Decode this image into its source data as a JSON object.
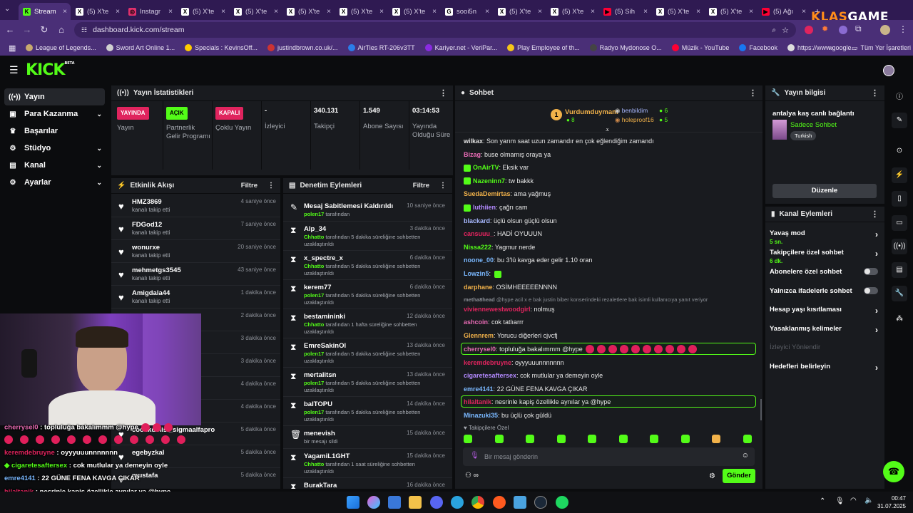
{
  "browser": {
    "tabs": [
      {
        "label": "Stream",
        "fav": "K",
        "color": "#53fc18"
      },
      {
        "label": "(5) X'te",
        "fav": "X",
        "color": "#ffffff"
      },
      {
        "label": "Instagr",
        "fav": "◎",
        "color": "#e1306c"
      },
      {
        "label": "(5) X'te",
        "fav": "X",
        "color": "#ffffff"
      },
      {
        "label": "(5) X'te",
        "fav": "X",
        "color": "#ffffff"
      },
      {
        "label": "(5) X'te",
        "fav": "X",
        "color": "#ffffff"
      },
      {
        "label": "(5) X'te",
        "fav": "X",
        "color": "#ffffff"
      },
      {
        "label": "(5) X'te",
        "fav": "X",
        "color": "#ffffff"
      },
      {
        "label": "sooi5n",
        "fav": "G",
        "color": "#ffffff"
      },
      {
        "label": "(5) X'te",
        "fav": "X",
        "color": "#ffffff"
      },
      {
        "label": "(5) X'te",
        "fav": "X",
        "color": "#ffffff"
      },
      {
        "label": "(5) Sih",
        "fav": "▶",
        "color": "#ff0033"
      },
      {
        "label": "(5) X'te",
        "fav": "X",
        "color": "#ffffff"
      },
      {
        "label": "(5) X'te",
        "fav": "X",
        "color": "#ffffff"
      },
      {
        "label": "(5) Ağı",
        "fav": "▶",
        "color": "#ff0033"
      }
    ],
    "url": "dashboard.kick.com/stream",
    "bookmarks": [
      {
        "label": "League of Legends...",
        "color": "#c8aa6e"
      },
      {
        "label": "Sword Art Online 1...",
        "color": "#d0d0d0"
      },
      {
        "label": "Specials : KevinsOff...",
        "color": "#ffcc00"
      },
      {
        "label": "justindbrown.co.uk/...",
        "color": "#cc3333"
      },
      {
        "label": "AirTies RT-206v3TT",
        "color": "#2b7de9"
      },
      {
        "label": "Kariyer.net - VeriPar...",
        "color": "#8a2be2"
      },
      {
        "label": "Play Employee of th...",
        "color": "#f5c518"
      },
      {
        "label": "Radyo Mydonose O...",
        "color": "#444444"
      },
      {
        "label": "Müzik - YouTube",
        "color": "#ff0033"
      },
      {
        "label": "Facebook",
        "color": "#1877f2"
      },
      {
        "label": "https://www.google...",
        "color": "#dddddd"
      }
    ],
    "all_bookmarks": "Tüm Yer İşaretleri",
    "watermark_a": "KLAS",
    "watermark_b": "GAME"
  },
  "kick": {
    "logo": "KICK",
    "logo_sup": "BETA",
    "sidebar": [
      {
        "label": "Yayın",
        "icon": "((•))",
        "active": true,
        "chev": false
      },
      {
        "label": "Para Kazanma",
        "icon": "▣",
        "active": false,
        "chev": true
      },
      {
        "label": "Başarılar",
        "icon": "♛",
        "active": false,
        "chev": false
      },
      {
        "label": "Stüdyo",
        "icon": "⚙",
        "active": false,
        "chev": true
      },
      {
        "label": "Kanal",
        "icon": "▤",
        "active": false,
        "chev": true
      },
      {
        "label": "Ayarlar",
        "icon": "⚙",
        "active": false,
        "chev": true
      }
    ],
    "stats": {
      "title": "Yayın İstatistikleri",
      "items": [
        {
          "badge": "YAYINDA",
          "badge_color": "#e0245e",
          "label": "Yayın"
        },
        {
          "badge": "AÇIK",
          "badge_color": "#53fc18",
          "label": "Partnerlik Gelir Programı"
        },
        {
          "badge": "KAPALI",
          "badge_color": "#e0245e",
          "label": "Çoklu Yayın"
        },
        {
          "value": "-",
          "label": "İzleyici"
        },
        {
          "value": "340.131",
          "label": "Takipçi"
        },
        {
          "value": "1.549",
          "label": "Abone Sayısı"
        },
        {
          "value": "03:14:53",
          "label": "Yayında Olduğu Süre"
        }
      ]
    },
    "activity": {
      "title": "Etkinlik Akışı",
      "filter": "Filtre",
      "rows": [
        {
          "name": "HMZ3869",
          "sub": "kanalı takip etti",
          "time": "4 saniye önce"
        },
        {
          "name": "FDGod12",
          "sub": "kanalı takip etti",
          "time": "7 saniye önce"
        },
        {
          "name": "wonurxe",
          "sub": "kanalı takip etti",
          "time": "20 saniye önce"
        },
        {
          "name": "mehmetgs3545",
          "sub": "kanalı takip etti",
          "time": "43 saniye önce"
        },
        {
          "name": "Amigdala44",
          "sub": "kanalı takip etti",
          "time": "1 dakika önce"
        },
        {
          "name": "",
          "sub": "",
          "time": "2 dakika önce"
        },
        {
          "name": "",
          "sub": "",
          "time": "3 dakika önce"
        },
        {
          "name": "",
          "sub": "",
          "time": "3 dakika önce"
        },
        {
          "name": "oldu!",
          "sub": "",
          "time": "4 dakika önce"
        },
        {
          "name": "",
          "sub": "",
          "time": "4 dakika önce"
        },
        {
          "name": "cocukdelisi_sigmaalfapro",
          "sub": "",
          "time": "5 dakika önce"
        },
        {
          "name": "egebyzkal",
          "sub": "",
          "time": "5 dakika önce"
        },
        {
          "name": "mustafa",
          "sub": "",
          "time": "5 dakika önce"
        }
      ]
    },
    "moderation": {
      "title": "Denetim Eylemleri",
      "filter": "Filtre",
      "rows": [
        {
          "icon": "✎",
          "name": "Mesaj Sabitlemesi Kaldırıldı",
          "by": "polen17",
          "rest": " tarafından",
          "time": "10 saniye önce"
        },
        {
          "icon": "⧗",
          "name": "Alp_34",
          "by": "Chhatto",
          "rest": " tarafından 5 dakika süreliğine sohbetten uzaklaştırıldı",
          "time": "3 dakika önce"
        },
        {
          "icon": "⧗",
          "name": "x_spectre_x",
          "by": "Chhatto",
          "rest": " tarafından 5 dakika süreliğine sohbetten uzaklaştırıldı",
          "time": "6 dakika önce"
        },
        {
          "icon": "⧗",
          "name": "kerem77",
          "by": "polen17",
          "rest": " tarafından 5 dakika süreliğine sohbetten uzaklaştırıldı",
          "time": "6 dakika önce"
        },
        {
          "icon": "⧗",
          "name": "bestamininki",
          "by": "Chhatto",
          "rest": " tarafından 1 hafta süreliğine sohbetten uzaklaştırıldı",
          "time": "12 dakika önce"
        },
        {
          "icon": "⧗",
          "name": "EmreSakinOl",
          "by": "polen17",
          "rest": " tarafından 5 dakika süreliğine sohbetten uzaklaştırıldı",
          "time": "13 dakika önce"
        },
        {
          "icon": "⧗",
          "name": "mertalitsn",
          "by": "polen17",
          "rest": " tarafından 5 dakika süreliğine sohbetten uzaklaştırıldı",
          "time": "13 dakika önce"
        },
        {
          "icon": "⧗",
          "name": "baITOPU",
          "by": "polen17",
          "rest": " tarafından 5 dakika süreliğine sohbetten uzaklaştırıldı",
          "time": "14 dakika önce"
        },
        {
          "icon": "🗑",
          "name": "menevish",
          "by": "",
          "rest": "bir mesajı sildi",
          "time": "15 dakika önce"
        },
        {
          "icon": "⧗",
          "name": "YagamiL1GHT",
          "by": "Chhatto",
          "rest": " tarafından 1 saat süreliğine sohbetten uzaklaştırıldı",
          "time": "15 dakika önce"
        },
        {
          "icon": "⧗",
          "name": "BurakTara",
          "by": "",
          "rest": "",
          "time": "16 dakika önce"
        }
      ]
    },
    "chat": {
      "title": "Sohbet",
      "top": [
        {
          "name": "Vurdumduymam",
          "count": "8"
        },
        {
          "name": "benbildim",
          "count": "6"
        },
        {
          "name": "holeproof16",
          "count": "5"
        }
      ],
      "messages": [
        {
          "user": "wilkax",
          "color": "#e0e0e0",
          "text": "Son yarım saat uzun zamandır en çok eğlendiğim zamandı",
          "hl": false
        },
        {
          "user": "Bizag",
          "color": "#e86bb5",
          "text": "buse olmamış oraya ya",
          "hl": false
        },
        {
          "user": "OnAirTV",
          "color": "#53fc18",
          "text": "Eksik var",
          "hl": false
        },
        {
          "user": "Nazeninn7",
          "color": "#53fc18",
          "text": "tw bakkk",
          "hl": false
        },
        {
          "user": "SuedaDemirtas",
          "color": "#f2b24a",
          "text": "ama yağmuş",
          "hl": false
        },
        {
          "user": "luthiien",
          "color": "#b38aff",
          "text": "çağrı cam",
          "hl": false
        },
        {
          "user": "blackard",
          "color": "#a8b8ff",
          "text": "üçlü olsun güçlü olsun",
          "hl": false
        },
        {
          "user": "cansuuu_",
          "color": "#e0245e",
          "text": "HADİ OYUUUN",
          "hl": false
        },
        {
          "user": "Nissa222",
          "color": "#53fc18",
          "text": "Yagmur nerde",
          "hl": false
        },
        {
          "user": "noone_00",
          "color": "#7ab8ff",
          "text": "bu 3'lü kavga eder gelir 1.10 oran",
          "hl": false
        },
        {
          "user": "Lowzin5",
          "color": "#7ab8ff",
          "text": "",
          "hl": false
        },
        {
          "user": "darphane",
          "color": "#f2b24a",
          "text": "OSİMHEEEEENNNN",
          "hl": false
        },
        {
          "user": "metha8head",
          "color": "#8b8f96",
          "text": "@hype acil x e bak justin biber konserindeki rezaletlere bak isimli kullanıcıya yanıt veriyor",
          "hl": false
        },
        {
          "user": "viviennewestwoodgirl",
          "color": "#e0245e",
          "text": "nolmuş",
          "hl": false
        },
        {
          "user": "ashcoin",
          "color": "#e86bb5",
          "text": "cok tatlıarrr",
          "hl": false
        },
        {
          "user": "Glennrem",
          "color": "#f2b24a",
          "text": "Yorucu diğerleri cjvcfj",
          "hl": false
        },
        {
          "user": "cherrysel0",
          "color": "#e86bb5",
          "text": "topluluğa bakalımmm @hype",
          "hl": true
        },
        {
          "user": "keremdebruyne",
          "color": "#e0245e",
          "text": "oyyyuuunnnnnnn",
          "hl": false
        },
        {
          "user": "cigaretesaftersex",
          "color": "#b38aff",
          "text": "cok mutlular ya demeyin oyle",
          "hl": false
        },
        {
          "user": "emre4141",
          "color": "#7ab8ff",
          "text": "22 GÜNE FENA KAVGA ÇIKAR",
          "hl": false
        },
        {
          "user": "hilaltanik",
          "color": "#e0245e",
          "text": "nesrinle kapiş özellikle aynılar ya @hype",
          "hl": true
        },
        {
          "user": "Minazuki35",
          "color": "#7ab8ff",
          "text": "bu üçlü çok güldü",
          "hl": false
        }
      ],
      "followers_only": "Takipçilere Özel",
      "placeholder": "Bir mesaj gönderin",
      "send": "Gönder"
    },
    "stream_info": {
      "title": "Yayın bilgisi",
      "stream_title": "antalya kaş canlı bağlantı",
      "category": "Sadece Sohbet",
      "tag": "Turkish",
      "edit": "Düzenle"
    },
    "channel_actions": {
      "title": "Kanal Eylemleri",
      "rows": [
        {
          "label": "Yavaş mod",
          "sub": "5 sn.",
          "kind": "arrow"
        },
        {
          "label": "Takipçilere özel sohbet",
          "sub": "6 dk.",
          "kind": "arrow"
        },
        {
          "label": "Abonelere özel sohbet",
          "sub": "",
          "kind": "toggle"
        },
        {
          "label": "Yalnızca ifadelerle sohbet",
          "sub": "",
          "kind": "toggle"
        },
        {
          "label": "Hesap yaşı kısıtlaması",
          "sub": "",
          "kind": "arrow"
        },
        {
          "label": "Yasaklanmış kelimeler",
          "sub": "",
          "kind": "arrow"
        },
        {
          "label": "İzleyici Yönlendir",
          "sub": "",
          "kind": "dim"
        },
        {
          "label": "Hedefleri belirleyin",
          "sub": "",
          "kind": "arrow"
        }
      ]
    }
  },
  "overlay_chat": [
    {
      "user": "cherrysel0",
      "color": "#e86bb5",
      "text": "topluluğa bakalımmm @hype"
    },
    {
      "user": "",
      "color": "#ffffff",
      "text": ""
    },
    {
      "user": "keremdebruyne",
      "color": "#e0245e",
      "text": "oyyyuuunnnnnnn"
    },
    {
      "user": "cigaretesaftersex",
      "color": "#53fc18",
      "text": "cok mutlular ya demeyin oyle"
    },
    {
      "user": "emre4141",
      "color": "#7ab8ff",
      "text": "22 GÜNE FENA KAVGA ÇIKAR"
    },
    {
      "user": "hilaltanik",
      "color": "#e0245e",
      "text": "nesrinle kapiş özellikle aynılar ya @hype"
    }
  ],
  "taskbar": {
    "time": "00:47",
    "date": "31.07.2025"
  }
}
